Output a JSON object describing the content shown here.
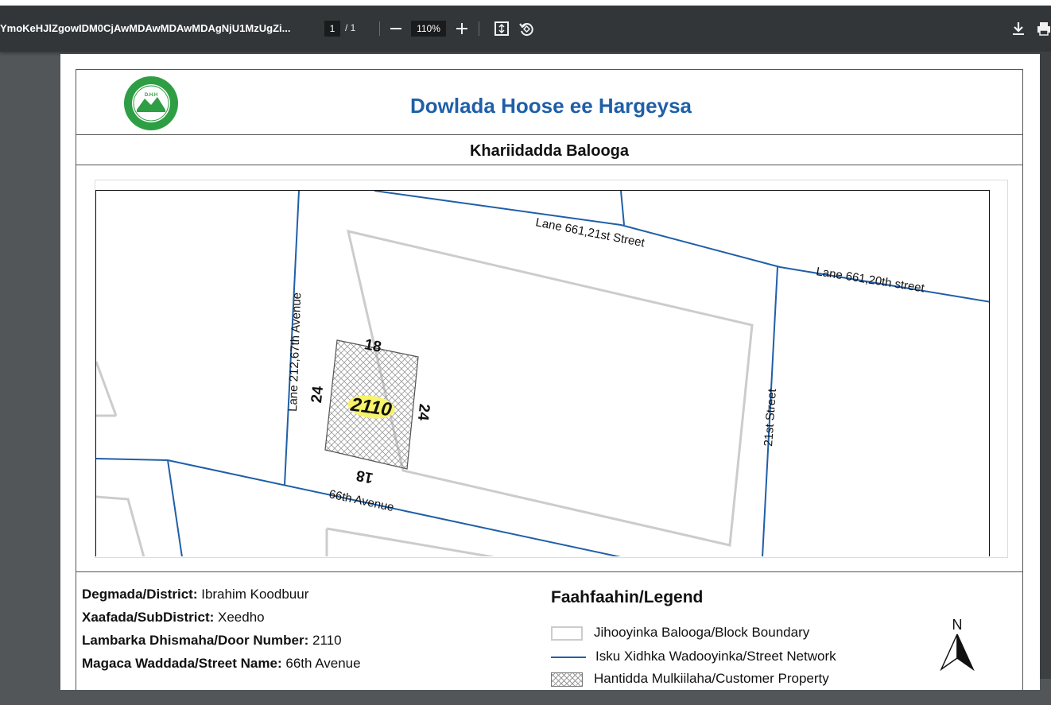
{
  "toolbar": {
    "filename": "YmoKeHJlZgowIDM0CjAwMDAwMDAwMDAgNjU1MzUgZi...",
    "page_current": "1",
    "page_total": "/ 1",
    "zoom": "110%",
    "icons": [
      "minus-icon",
      "plus-icon",
      "fit-page-icon",
      "rotate-icon",
      "download-icon",
      "print-icon"
    ]
  },
  "doc": {
    "title": "Dowlada Hoose ee Hargeysa",
    "subtitle": "Khariidadda Balooga",
    "logo_text_top": "DOWLADDA HOOSE EE HARGEYSA",
    "logo_text_mid": "D.H.H",
    "logo_text_bottom": "HARGEISA MUNICIPALITY"
  },
  "map": {
    "streets": {
      "lane_21st": "Lane 661,21st Street",
      "lane_20th": "Lane 661,20th street",
      "lane_67th": "Lane 212,67th Avenue",
      "street_21st": "21st Street",
      "ave_66th": "66th Avenue"
    },
    "parcel": {
      "number": "2110",
      "dim_top": "18",
      "dim_bottom": "18",
      "dim_left": "24",
      "dim_right": "24"
    }
  },
  "info": {
    "district_label": "Degmada/District:",
    "district_value": "Ibrahim Koodbuur",
    "subdistrict_label": "Xaafada/SubDistrict:",
    "subdistrict_value": "Xeedho",
    "door_label": "Lambarka Dhismaha/Door Number:",
    "door_value": "2110",
    "street_label": "Magaca Waddada/Street Name:",
    "street_value": "66th Avenue"
  },
  "legend": {
    "title": "Faahfaahin/Legend",
    "items": [
      "Jihooyinka Balooga/Block Boundary",
      "Isku Xidhka Wadooyinka/Street Network",
      "Hantidda Mulkiilaha/Customer Property"
    ],
    "north": "N"
  },
  "colors": {
    "toolbar": "#323639",
    "street": "#1f5fa8",
    "block": "#cccccc",
    "highlight": "#f7f36a"
  }
}
